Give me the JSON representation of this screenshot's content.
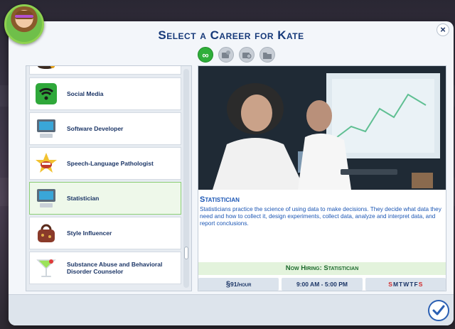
{
  "dialog": {
    "title": "Select a Career for Kate",
    "close_glyph": "×"
  },
  "filters": [
    {
      "icon": "infinity-icon",
      "glyph": "∞",
      "active": true
    },
    {
      "icon": "part-time-icon",
      "active": false
    },
    {
      "icon": "freelance-icon",
      "active": false
    },
    {
      "icon": "folder-icon",
      "active": false
    }
  ],
  "careers": [
    {
      "label": "",
      "icon": "partial-career-icon"
    },
    {
      "label": "Social Media",
      "icon": "wifi-icon"
    },
    {
      "label": "Software Developer",
      "icon": "computer-icon"
    },
    {
      "label": "Speech-Language Pathologist",
      "icon": "speech-mouth-icon"
    },
    {
      "label": "Statistician",
      "icon": "computer-icon",
      "selected": true
    },
    {
      "label": "Style Influencer",
      "icon": "handbag-icon"
    },
    {
      "label": "Substance Abuse and Behavioral Disorder Counselor",
      "icon": "cocktail-icon"
    }
  ],
  "detail": {
    "title": "Statistician",
    "description": "Statisticians practice the science of using data to make decisions. They decide what data they need and how to collect it, design experiments, collect data, analyze and interpret data, and report conclusions.",
    "hiring": "Now Hiring: Statistician",
    "pay_symbol": "§",
    "pay": "91/hour",
    "hours": "9:00 AM - 5:00 PM",
    "days": [
      "S",
      "M",
      "T",
      "W",
      "T",
      "F",
      "S"
    ],
    "days_off": [
      0,
      6
    ]
  },
  "colors": {
    "title": "#173a7a",
    "accent": "#1b56b4",
    "hiring_bg": "#e3f3dc",
    "day_off": "#d12c2c",
    "active_filter": "#2fae3a"
  }
}
